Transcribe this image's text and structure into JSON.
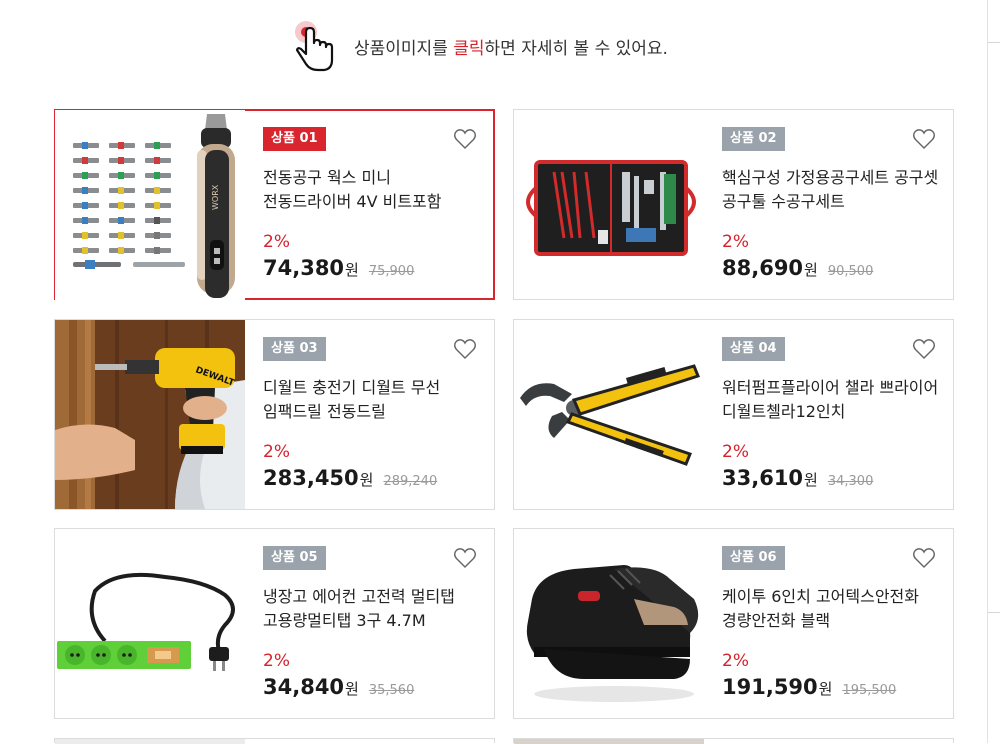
{
  "hint": {
    "before": "상품이미지를 ",
    "highlight": "클릭",
    "after": "하면 자세히 볼 수 있어요.",
    "icon": "hand-pointer-click-icon"
  },
  "colors": {
    "accent": "#d9262e",
    "badge_gray": "#9aa2ab",
    "discount": "#d4232d"
  },
  "products": [
    {
      "badge": "상품 01",
      "name": "전동공구 웍스 미니 전동드라이버 4V 비트포함",
      "discount": "2%",
      "price": "74,380",
      "unit": "원",
      "original_price": "75,900",
      "selected": true
    },
    {
      "badge": "상품 02",
      "name": "핵심구성 가정용공구세트 공구셋 공구툴 수공구세트",
      "discount": "2%",
      "price": "88,690",
      "unit": "원",
      "original_price": "90,500",
      "selected": false
    },
    {
      "badge": "상품 03",
      "name": "디월트 충전기 디월트 무선 임팩드릴 전동드릴",
      "discount": "2%",
      "price": "283,450",
      "unit": "원",
      "original_price": "289,240",
      "selected": false
    },
    {
      "badge": "상품 04",
      "name": "워터펌프플라이어 챌라 쁘라이어 디월트첼라12인치",
      "discount": "2%",
      "price": "33,610",
      "unit": "원",
      "original_price": "34,300",
      "selected": false
    },
    {
      "badge": "상품 05",
      "name": "냉장고 에어컨 고전력 멀티탭 고용량멀티탭 3구 4.7M",
      "discount": "2%",
      "price": "34,840",
      "unit": "원",
      "original_price": "35,560",
      "selected": false
    },
    {
      "badge": "상품 06",
      "name": "케이투 6인치 고어텍스안전화 경량안전화 블랙",
      "discount": "2%",
      "price": "191,590",
      "unit": "원",
      "original_price": "195,500",
      "selected": false
    }
  ]
}
